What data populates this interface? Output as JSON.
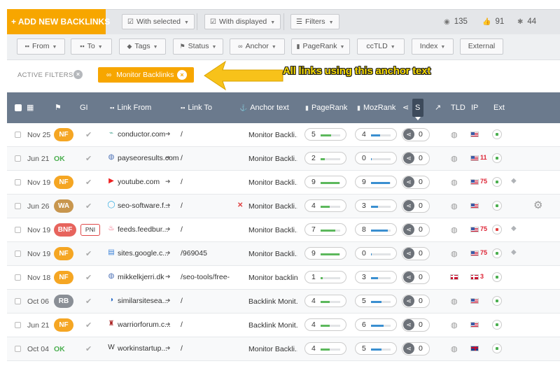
{
  "toolbar": {
    "add_label": "+ ADD NEW BACKLINKS",
    "with_selected": "With selected",
    "with_displayed": "With displayed",
    "filters": "Filters",
    "stats": [
      {
        "icon": "eye-icon",
        "value": "135"
      },
      {
        "icon": "thumbs-up-icon",
        "value": "91"
      },
      {
        "icon": "bug-icon",
        "value": "44"
      }
    ]
  },
  "filter_buttons": [
    "From",
    "To",
    "Tags",
    "Status",
    "Anchor",
    "PageRank",
    "ccTLD",
    "Index",
    "External"
  ],
  "active_filters": {
    "label": "ACTIVE FILTERS",
    "chip_label": "Monitor Backlinks"
  },
  "annotation": "All links using this anchor text",
  "columns": {
    "gi": "GI",
    "link_from": "Link From",
    "link_to": "Link To",
    "anchor": "Anchor text",
    "pagerank": "PageRank",
    "mozrank": "MozRank",
    "s": "S",
    "tld": "TLD",
    "ip": "IP",
    "ext": "Ext"
  },
  "colors": {
    "accent": "#f7a600",
    "header": "#6b7a8d",
    "pr_fill": "#5cb85c",
    "moz_fill": "#3a8fd0",
    "ext_green": "#4caf50",
    "ext_red": "#e04040"
  },
  "rows": [
    {
      "date": "Nov 25",
      "status": "NF",
      "status_kind": "nf",
      "pni": "",
      "favicon": "conductor-favicon",
      "domain": "conductor.com",
      "link_to": "/",
      "bad_anchor": false,
      "anchor": "Monitor Backli...",
      "pr": "5",
      "pr_level": 0.55,
      "moz": "4",
      "moz_level": 0.45,
      "s": "0",
      "tld_flag": "us",
      "ip_count": "",
      "ext_color": "green",
      "tagged": false,
      "gear": false
    },
    {
      "date": "Jun 21",
      "status": "OK",
      "status_kind": "ok",
      "pni": "",
      "favicon": "globe-favicon",
      "domain": "payseoresults.com",
      "link_to": "/",
      "bad_anchor": false,
      "anchor": "Monitor Backli...",
      "pr": "2",
      "pr_level": 0.2,
      "moz": "0",
      "moz_level": 0.05,
      "s": "0",
      "tld_flag": "us",
      "ip_count": "11",
      "ext_color": "green",
      "tagged": false,
      "gear": false
    },
    {
      "date": "Nov 19",
      "status": "NF",
      "status_kind": "nf",
      "pni": "",
      "favicon": "youtube-favicon",
      "domain": "youtube.com",
      "link_to": "/",
      "bad_anchor": false,
      "anchor": "Monitor Backli...",
      "pr": "9",
      "pr_level": 0.95,
      "moz": "9",
      "moz_level": 0.95,
      "s": "0",
      "tld_flag": "us",
      "ip_count": "75",
      "ext_color": "green",
      "tagged": true,
      "gear": false
    },
    {
      "date": "Jun 26",
      "status": "WA",
      "status_kind": "wa",
      "pni": "",
      "favicon": "seo-software-favicon",
      "domain": "seo-software.f...",
      "link_to": "/",
      "bad_anchor": true,
      "anchor": "Monitor Backli...",
      "pr": "4",
      "pr_level": 0.45,
      "moz": "3",
      "moz_level": 0.35,
      "s": "0",
      "tld_flag": "us",
      "ip_count": "",
      "ext_color": "green",
      "tagged": false,
      "gear": true
    },
    {
      "date": "Nov 19",
      "status": "BNF",
      "status_kind": "bnf",
      "pni": "PNI",
      "favicon": "feedburner-favicon",
      "domain": "feeds.feedbur...",
      "link_to": "/",
      "bad_anchor": false,
      "anchor": "Monitor Backli...",
      "pr": "7",
      "pr_level": 0.75,
      "moz": "8",
      "moz_level": 0.85,
      "s": "0",
      "tld_flag": "us",
      "ip_count": "75",
      "ext_color": "red",
      "tagged": true,
      "gear": false
    },
    {
      "date": "Nov 19",
      "status": "NF",
      "status_kind": "nf",
      "pni": "",
      "favicon": "google-sites-favicon",
      "domain": "sites.google.c...",
      "link_to": "/969045",
      "bad_anchor": false,
      "anchor": "Monitor Backli...",
      "pr": "9",
      "pr_level": 0.95,
      "moz": "0",
      "moz_level": 0.05,
      "s": "0",
      "tld_flag": "us",
      "ip_count": "75",
      "ext_color": "green",
      "tagged": true,
      "gear": false
    },
    {
      "date": "Nov 18",
      "status": "NF",
      "status_kind": "nf",
      "pni": "",
      "favicon": "globe-favicon",
      "domain": "mikkelkjerri.dk",
      "link_to": "/seo-tools/free-...",
      "bad_anchor": false,
      "anchor": "Monitor backlin...",
      "pr": "1",
      "pr_level": 0.1,
      "moz": "3",
      "moz_level": 0.35,
      "s": "0",
      "tld_flag": "dk",
      "ip_count": "3",
      "ext_color": "green",
      "tagged": false,
      "gear": false
    },
    {
      "date": "Oct 06",
      "status": "RB",
      "status_kind": "rb",
      "pni": "",
      "favicon": "similarsites-favicon",
      "domain": "similarsitesea...",
      "link_to": "/",
      "bad_anchor": false,
      "anchor": "Backlink Monit...",
      "pr": "4",
      "pr_level": 0.45,
      "moz": "5",
      "moz_level": 0.55,
      "s": "0",
      "tld_flag": "us",
      "ip_count": "",
      "ext_color": "green",
      "tagged": false,
      "gear": false
    },
    {
      "date": "Jun 21",
      "status": "NF",
      "status_kind": "nf",
      "pni": "",
      "favicon": "warriorforum-favicon",
      "domain": "warriorforum.c...",
      "link_to": "/",
      "bad_anchor": false,
      "anchor": "Backlink Monit...",
      "pr": "4",
      "pr_level": 0.45,
      "moz": "6",
      "moz_level": 0.65,
      "s": "0",
      "tld_flag": "us",
      "ip_count": "",
      "ext_color": "green",
      "tagged": false,
      "gear": false
    },
    {
      "date": "Oct 04",
      "status": "OK",
      "status_kind": "ok",
      "pni": "",
      "favicon": "workinstartup-favicon",
      "domain": "workinstartup...",
      "link_to": "/",
      "bad_anchor": false,
      "anchor": "Monitor Backli...",
      "pr": "4",
      "pr_level": 0.45,
      "moz": "5",
      "moz_level": 0.55,
      "s": "0",
      "tld_flag": "gb",
      "ip_count": "",
      "ext_color": "green",
      "tagged": false,
      "gear": false
    }
  ]
}
